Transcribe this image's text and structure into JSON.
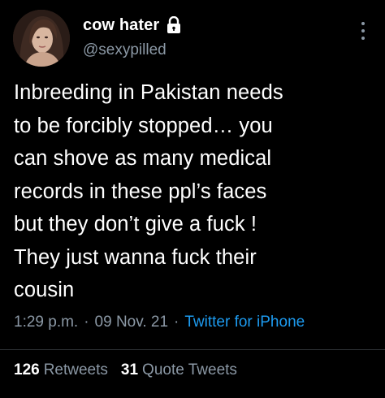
{
  "tweet": {
    "author": {
      "display_name": "cow hater",
      "handle": "@sexypilled",
      "protected_icon": "lock-icon",
      "avatar_icon": "profile-photo"
    },
    "menu_icon": "more-vertical-icon",
    "text": "Inbreeding in Pakistan needs\nto be forcibly stopped… you\ncan shove as many medical\nrecords in these ppl’s faces\nbut they don’t give a fuck !\nThey just wanna fuck their\ncousin",
    "meta": {
      "time": "1:29 p.m.",
      "separator": "·",
      "date": "09 Nov. 21",
      "source": "Twitter for iPhone"
    },
    "stats": {
      "retweets_count": "126",
      "retweets_label": "Retweets",
      "quotes_count": "31",
      "quotes_label": "Quote Tweets"
    }
  },
  "colors": {
    "background": "#000000",
    "text_primary": "#ffffff",
    "text_secondary": "#8b98a5",
    "link": "#1d9bf0",
    "divider": "#2f3336"
  }
}
